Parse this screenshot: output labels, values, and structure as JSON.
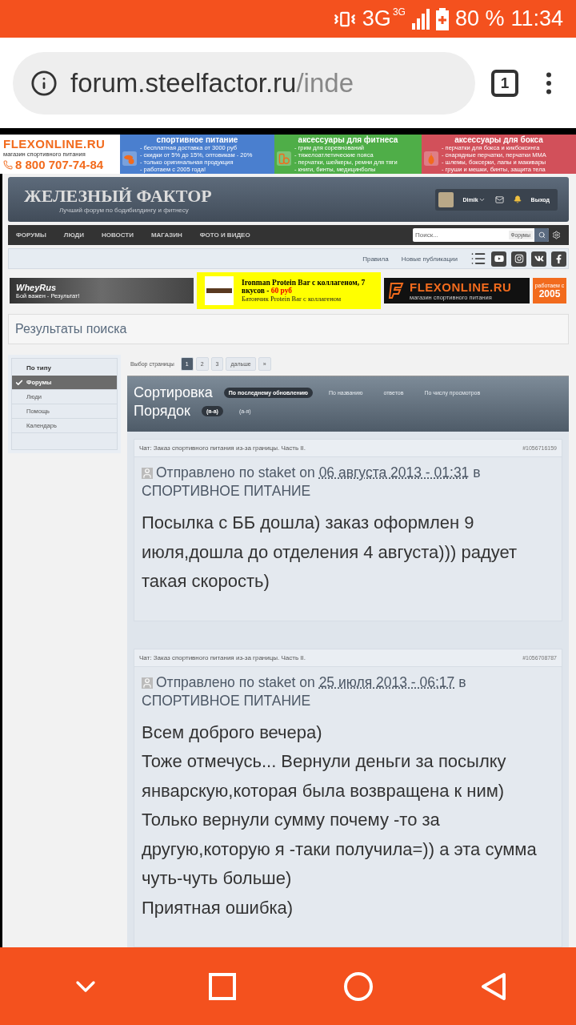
{
  "status_bar": {
    "network": "3G",
    "network_badge": "3G",
    "battery": "80 %",
    "time": "11:34"
  },
  "browser": {
    "url_host": "forum.steelfactor.ru",
    "url_path": "/inde",
    "tab_count": "1"
  },
  "top_banner": [
    {
      "kind": "logo",
      "title": "FLEXONLINE.RU",
      "subtitle": "магазин спортивного питания",
      "phone": "8 800 707-74-84"
    },
    {
      "kind": "promo",
      "color": "#4a7fcf",
      "title": "спортивное питание",
      "lines": [
        "- бесплатная доставка от 3000 руб",
        "- скидки от 5% до 15%, оптовикам - 20%",
        "- только оригинальная продукция",
        "- работаем с 2005 года!"
      ]
    },
    {
      "kind": "promo",
      "color": "#4fae48",
      "title": "аксессуары для фитнеса",
      "lines": [
        "- грим для соревнований",
        "- тяжелоатлетические пояса",
        "- перчатки, шейкеры, ремни для тяги",
        "- книги, бинты, медицинболы"
      ]
    },
    {
      "kind": "promo",
      "color": "#d2505a",
      "title": "аксессуары для бокса",
      "lines": [
        "- перчатки для бокса и кикбоксинга",
        "- снарядные перчатки, перчатки ММА",
        "- шлемы, боксерки, лапы и макивары",
        "- груши и мешки, бинты, защита тела"
      ]
    }
  ],
  "header": {
    "site_title": "ЖЕЛЕЗНЫЙ ФАКТОР",
    "tagline": "Лучший форум по бодибилдингу и фитнесу",
    "user": "Dimik",
    "logout": "Выход"
  },
  "nav": {
    "items": [
      "ФОРУМЫ",
      "ЛЮДИ",
      "НОВОСТИ",
      "МАГАЗИН",
      "ФОТО И ВИДЕО"
    ],
    "search": {
      "placeholder": "Поиск...",
      "scope": "Форумы"
    }
  },
  "subnav": {
    "links": [
      "Правила",
      "Новые публикации"
    ]
  },
  "ads": {
    "left": {
      "title": "WheyRus",
      "caption": "Бой важен - Результат!"
    },
    "middle": {
      "title": "Ironman Protein Bar с коллагеном, 7 вкусов - ",
      "price": "60 руб",
      "subtitle": "Батончик Protein Bar с коллагеном"
    },
    "right": {
      "logo": "FLEXONLINE.RU",
      "subtitle": "магазин спортивного питания",
      "since": "работаем с",
      "year": "2005"
    }
  },
  "page_title": "Результаты поиска",
  "sidebar": {
    "heading": "По типу",
    "items": [
      {
        "label": "Форумы",
        "selected": true
      },
      {
        "label": "Люди",
        "selected": false
      },
      {
        "label": "Помощь",
        "selected": false
      },
      {
        "label": "Календарь",
        "selected": false
      }
    ]
  },
  "pagination": {
    "label": "Выбор страницы",
    "pages": [
      {
        "label": "1",
        "selected": true
      },
      {
        "label": "2",
        "selected": false
      },
      {
        "label": "3",
        "selected": false
      }
    ],
    "next": "дальше",
    "last": "»"
  },
  "sort": {
    "label": "Сортировка",
    "options": [
      {
        "label": "По последнему обновлению",
        "selected": true
      },
      {
        "label": "По названию",
        "selected": false
      },
      {
        "label": "ответов",
        "selected": false
      },
      {
        "label": "По числу просмотров",
        "selected": false
      }
    ]
  },
  "order": {
    "label": "Порядок",
    "options": [
      {
        "label": "(я-а)",
        "selected": true
      },
      {
        "label": "(а-я)",
        "selected": false
      }
    ]
  },
  "posts": [
    {
      "thread": "Чат: Заказ спортивного питания из-за границы. Часть II.",
      "id": "#1056716159",
      "byline_start": "Отправлено по staket on ",
      "date": "06 августа 2013 - 01:31",
      "byline_end": " в СПОРТИВНОЕ ПИТАНИЕ",
      "body": [
        "Посылка с ББ дошла) заказ оформлен 9 июля,дошла до отделения 4 августа))) радует такая скорость)"
      ]
    },
    {
      "thread": "Чат: Заказ спортивного питания из-за границы. Часть II.",
      "id": "#1056708787",
      "byline_start": "Отправлено по staket on ",
      "date": "25 июля 2013 - 06:17",
      "byline_end": " в СПОРТИВНОЕ ПИТАНИЕ",
      "body": [
        "Всем доброго вечера)",
        "Тоже отмечусь... Вернули деньги за посылку январскую,которая была возвращена к ним)",
        "Только вернули сумму почему -то за другую,которую я -таки получила=)) а эта сумма чуть-чуть больше)",
        "Приятная ошибка)"
      ]
    }
  ]
}
